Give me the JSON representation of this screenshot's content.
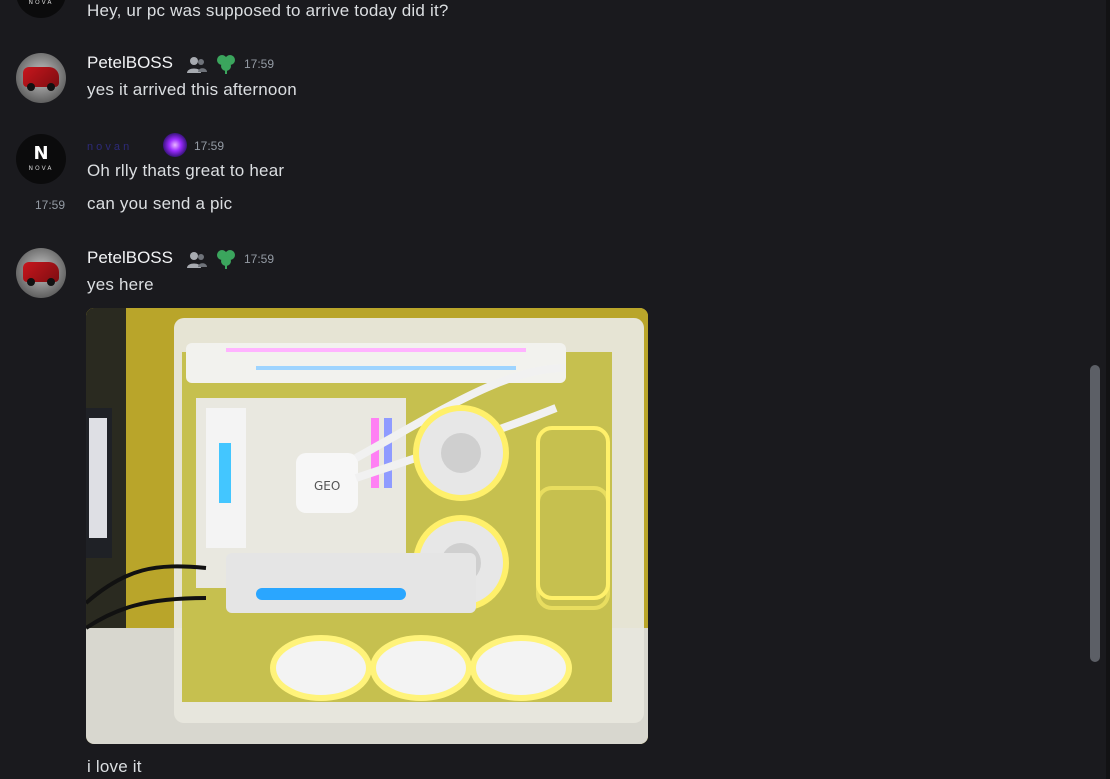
{
  "messages": {
    "m0": {
      "text": "Hey, ur pc was supposed to arrive today did it?"
    },
    "m1": {
      "author": "PetelBOSS",
      "timestamp": "17:59",
      "text": "yes it arrived this afternoon"
    },
    "m2": {
      "author": "n o v a  n",
      "timestamp": "17:59",
      "text": "Oh rlly thats great to hear"
    },
    "m3": {
      "timestamp": "17:59",
      "text": "can you send a pic"
    },
    "m4": {
      "author": "PetelBOSS",
      "timestamp": "17:59",
      "text": "yes here",
      "image_label": "GEO"
    },
    "m5": {
      "text": "i love it"
    }
  },
  "avatars": {
    "nova_text": "NOVA",
    "nova_letter": "N"
  },
  "icons": {
    "friend": "person-icon",
    "role": "clover-icon",
    "nitro": "purple-orb-icon"
  },
  "colors": {
    "background": "#1a1a1e",
    "text": "#dbdee1",
    "timestamp": "#949ba4",
    "clover": "#3ba55d"
  }
}
